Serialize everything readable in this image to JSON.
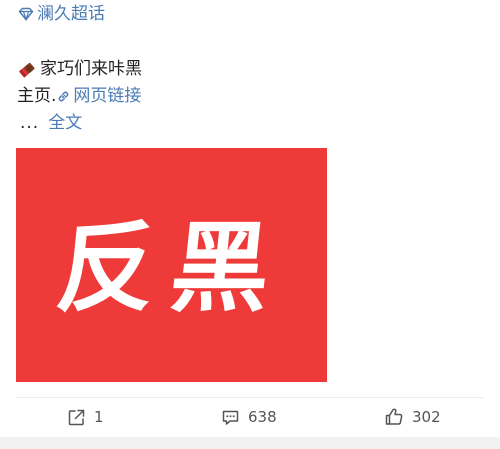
{
  "topic": {
    "label": "澜久超话",
    "icon": "diamond-icon"
  },
  "post": {
    "emoji": "chocolate-bar-emoji",
    "line1": "家巧们来咔黑",
    "line2_prefix": "主页.",
    "link_label": "网页链接",
    "ellipsis": "...",
    "full_text_label": "全文"
  },
  "image": {
    "text": "反黑",
    "background_color": "#ef3a3a"
  },
  "actions": {
    "repost_count": "1",
    "comment_count": "638",
    "like_count": "302"
  },
  "colors": {
    "link": "#4a7bb6",
    "text": "#222222"
  }
}
